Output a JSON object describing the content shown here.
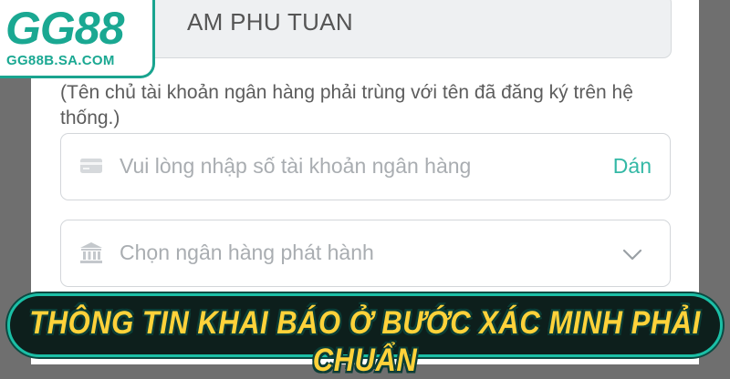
{
  "logo": {
    "main": "GG88",
    "sub": "GG88B.SA.COM"
  },
  "form": {
    "account_name_value": "AM PHU TUAN",
    "hint": "(Tên chủ tài khoản ngân hàng phải trùng với tên đã đăng ký trên hệ thống.)",
    "account_number": {
      "placeholder": "Vui lòng nhập số tài khoản ngân hàng",
      "paste_label": "Dán",
      "icon": "card-icon"
    },
    "bank_select": {
      "placeholder": "Chọn ngân hàng phát hành",
      "icon": "bank-icon",
      "dropdown_icon": "chevron-down-icon"
    }
  },
  "banner": {
    "text": "THÔNG TIN KHAI BÁO Ở BƯỚC XÁC MINH PHẢI CHUẨN"
  },
  "colors": {
    "accent": "#33b8a5",
    "brand": "#1aa892",
    "banner_text": "#ffd23a",
    "banner_bg": "#0d1f1c"
  }
}
